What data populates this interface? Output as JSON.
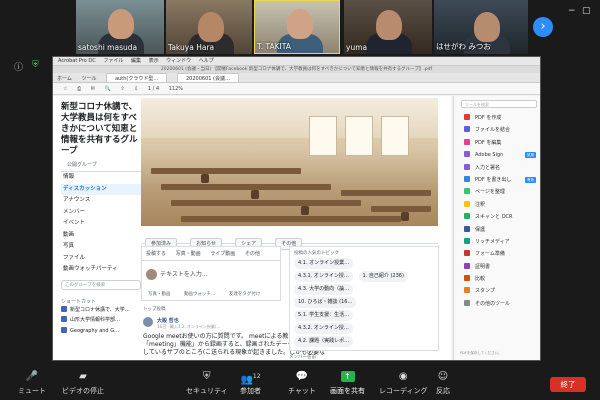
{
  "participants": [
    {
      "name": "satoshi masuda"
    },
    {
      "name": "Takuya Hara"
    },
    {
      "name": "T. TAKITA"
    },
    {
      "name": "yuma"
    },
    {
      "name": "はせがわ みつお"
    }
  ],
  "acrobat": {
    "menubar": [
      "Acrobat Pro DC",
      "ファイル",
      "編集",
      "表示",
      "ウィンドウ",
      "ヘルプ"
    ],
    "window_title": "20200601 (会議・当日) 【開催Facebook 新型コロナ休講で、大学教員は何をすべきかについて知恵と情報を共有するグループ】.pdf",
    "tabs": [
      "ホーム",
      "ツール",
      "auth(クラウド型…",
      "20200601 (会議…"
    ],
    "page_indicator": "1 / 4",
    "zoom": "112%",
    "toolbar_items": [
      "☆",
      "⎙",
      "✉",
      "🔍",
      "⇧",
      "⇩"
    ]
  },
  "group": {
    "title": "新型コロナ休講で、大学教員は何をすべきかについて知恵と情報を共有するグループ",
    "subtitle": "公開グループ",
    "nav": [
      "情報",
      "ディスカッション",
      "アナウンス",
      "メンバー",
      "イベント",
      "動画",
      "写真",
      "ファイル",
      "動画ウォッチパーティ"
    ],
    "active_nav": "ディスカッション",
    "search_placeholder": "このグループを検索",
    "shortcuts_heading": "ショートカット",
    "shortcuts": [
      "新型コロナ休講で、大学…",
      "山形大学情報科学部…",
      "Geography and G…"
    ],
    "actions": [
      "参加済み",
      "お知らせ",
      "シェア",
      "その他"
    ],
    "composer": {
      "tabs": [
        "投稿する",
        "写真・動画",
        "ライブ動画",
        "その他"
      ],
      "placeholder": "テキストを入力...",
      "footer": [
        "写真・動画",
        "動画ウォッチ…",
        "友達をタグ付け"
      ]
    },
    "post": {
      "heading": "トップ投稿",
      "author": "大殿 哲也",
      "meta": "16日 · 輸入3.2: オンライン授業/…",
      "text": "Google meetお使いの方に質問です。 meetによる教員の様子を「meeting」機能」から録画すると、録画されたデータがなぜか登録しているサブのところ(こ送られる現象が起きました。しかも必要な"
    },
    "topics_heading": "投稿の人気のトピック",
    "topics": [
      "4.1. オンライン授業…",
      "4.3.1. オンライン授…",
      "4.3. 大学の動向（論…",
      "10. ひろば・雑談 (16…",
      "5.1. 学生支援：生活…",
      "4.3.2. オンライン授…",
      "4.2. 課題（実践レポ…"
    ],
    "topics_right": [
      "1. 自己紹介 (236)"
    ],
    "member_heading": "メンバー名前"
  },
  "tools_panel": {
    "search_placeholder": "ツールを検索",
    "items": [
      {
        "label": "PDF を作成",
        "color": "#e03c31",
        "badge": ""
      },
      {
        "label": "ファイルを結合",
        "color": "#5f5fd6",
        "badge": ""
      },
      {
        "label": "PDF を編集",
        "color": "#e83e8c",
        "badge": ""
      },
      {
        "label": "Adobe Sign",
        "color": "#8a5cd0",
        "badge": "試用"
      },
      {
        "label": "入力と署名",
        "color": "#8a5cd0",
        "badge": ""
      },
      {
        "label": "PDF を書き出し",
        "color": "#2e86de",
        "badge": "有効"
      },
      {
        "label": "ページを整理",
        "color": "#2ecc71",
        "badge": ""
      },
      {
        "label": "注釈",
        "color": "#f1c40f",
        "badge": ""
      },
      {
        "label": "スキャンと OCR",
        "color": "#27ae60",
        "badge": ""
      },
      {
        "label": "保護",
        "color": "#3b5998",
        "badge": ""
      },
      {
        "label": "リッチメディア",
        "color": "#16a085",
        "badge": ""
      },
      {
        "label": "フォーム準備",
        "color": "#c0392b",
        "badge": ""
      },
      {
        "label": "証明書",
        "color": "#8e44ad",
        "badge": ""
      },
      {
        "label": "比較",
        "color": "#d35400",
        "badge": ""
      },
      {
        "label": "スタンプ",
        "color": "#e67e22",
        "badge": ""
      },
      {
        "label": "その他のツール",
        "color": "#7f8c8d",
        "badge": ""
      }
    ],
    "footer": "PDFを保存してください。"
  },
  "zoom_controls": {
    "items": [
      {
        "label": "ミュート",
        "icon": "🎤"
      },
      {
        "label": "ビデオの停止",
        "icon": "▰"
      },
      {
        "label": "セキュリティ",
        "icon": "⛨"
      },
      {
        "label": "参加者",
        "icon": "👥"
      },
      {
        "label": "チャット",
        "icon": "💬"
      },
      {
        "label": "画面を共有",
        "icon": "↑"
      },
      {
        "label": "レコーディング",
        "icon": "◉"
      },
      {
        "label": "反応",
        "icon": "☺"
      }
    ],
    "participant_count": "12",
    "end_label": "終了"
  }
}
